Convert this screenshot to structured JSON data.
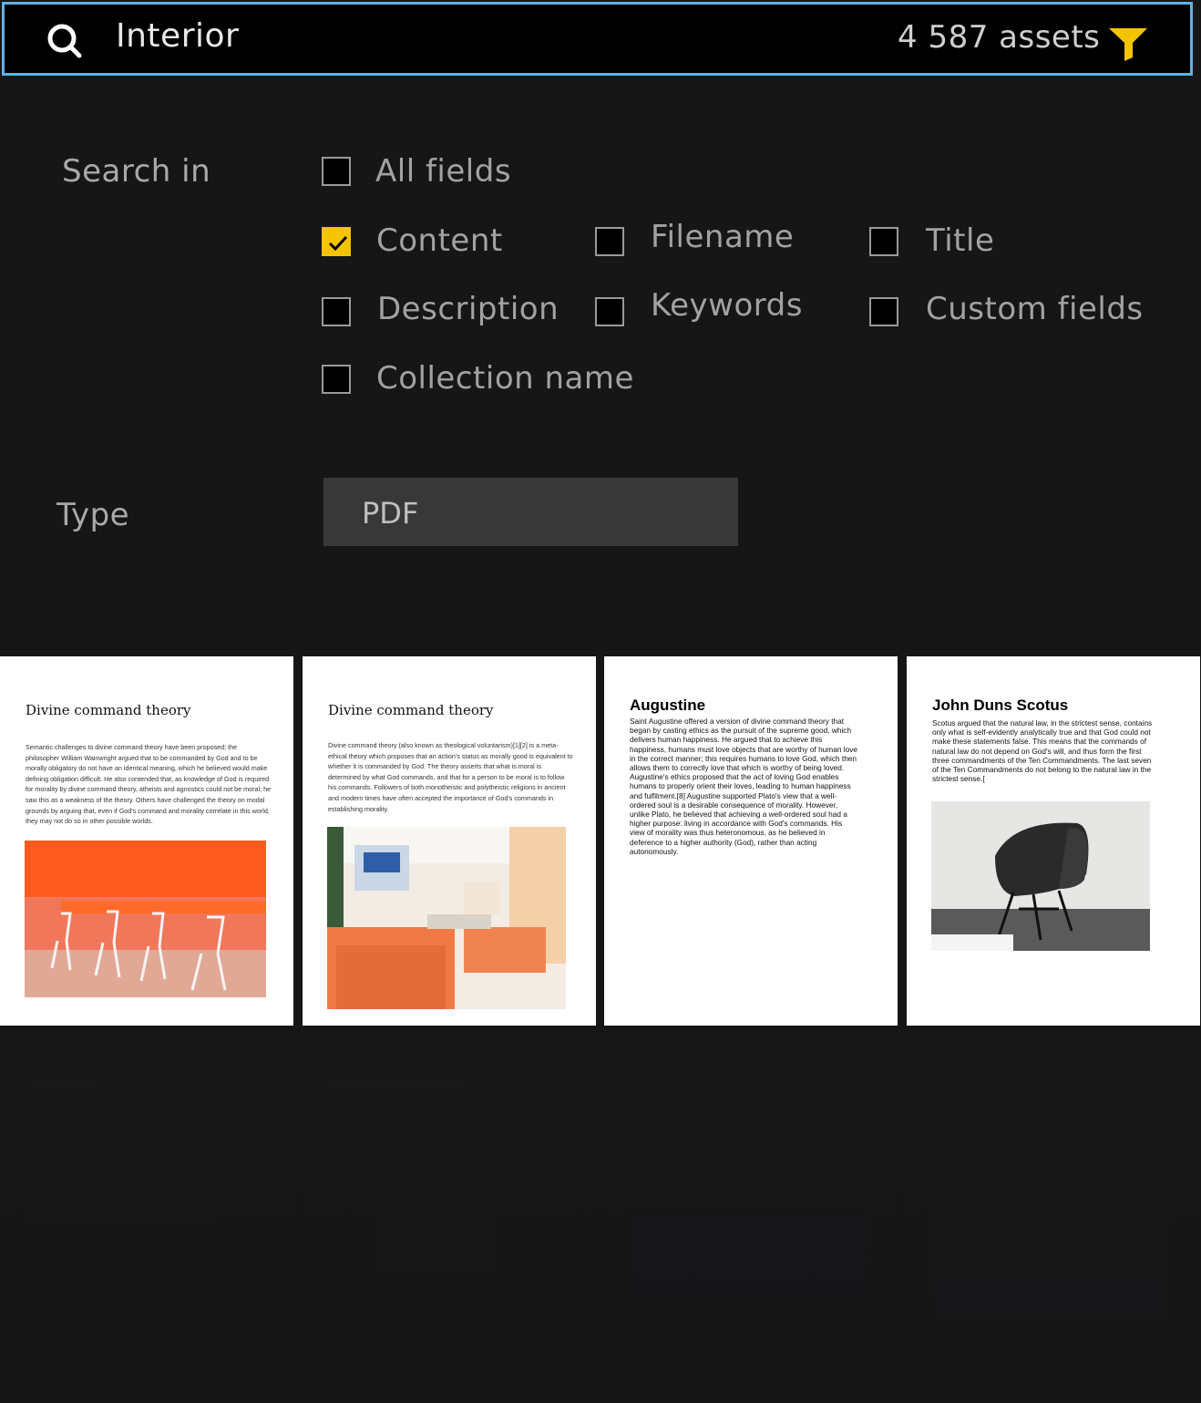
{
  "search": {
    "query": "Interior",
    "asset_count": "4 587 assets"
  },
  "search_in": {
    "label": "Search in",
    "options": [
      {
        "label": "All fields",
        "checked": false
      },
      {
        "label": "Content",
        "checked": true
      },
      {
        "label": "Filename",
        "checked": false
      },
      {
        "label": "Title",
        "checked": false
      },
      {
        "label": "Description",
        "checked": false
      },
      {
        "label": "Keywords",
        "checked": false
      },
      {
        "label": "Custom fields",
        "checked": false
      },
      {
        "label": "Collection name",
        "checked": false
      }
    ]
  },
  "type": {
    "label": "Type",
    "value": "PDF"
  },
  "results": [
    {
      "title": "Divine command theory",
      "body": "Semantic challenges to divine command theory have been proposed; the philosopher William Wainwright argued that to be commanded by God and to be morally obligatory do not have an identical meaning, which he believed would make defining obligation difficult. He also contended that, as knowledge of God is required for morality by divine command theory, atheists and agnostics could not be moral; he saw this as a weakness of the theory. Others have challenged the theory on modal grounds by arguing that, even if God's command and morality correlate in this world, they may not do so in other possible worlds."
    },
    {
      "title": "Divine command theory",
      "body": "Divine command theory (also known as theological voluntarism)[1][2] is a meta-ethical theory which proposes that an action's status as morally good is equivalent to whether it is commanded by God. The theory asserts that what is moral is determined by what God commands, and that for a person to be moral is to follow his commands. Followers of both monotheistic and polytheistic religions in ancient and modern times have often accepted the importance of God's commands in establishing morality."
    },
    {
      "title": "Augustine",
      "body": "Saint Augustine offered a version of divine command theory that began by casting ethics as the pursuit of the supreme good, which delivers human happiness. He argued that to achieve this happiness, humans must love objects that are worthy of human love in the correct manner; this requires humans to love God, which then allows them to correctly love that which is worthy of being loved. Augustine's ethics proposed that the act of loving God enables humans to properly orient their loves, leading to human happiness and fulfilment.[8] Augustine supported Plato's view that a well-ordered soul is a desirable consequence of morality. However, unlike Plato, he believed that achieving a well-ordered soul had a higher purpose: living in accordance with God's commands. His view of morality was thus heteronomous, as he believed in deference to a higher authority (God), rather than acting autonomously."
    },
    {
      "title": "John Duns Scotus",
      "body": "Scotus argued that the natural law, in the strictest sense, contains only what is self-evidently analytically true and that God could not make these statements false. This means that the commands of natural law do not depend on God's will, and thus form the first three commandments of the Ten Commandments. The last seven of the Ten Commandments do not belong to the natural law in the strictest sense.["
    }
  ],
  "colors": {
    "accent": "#f5c400",
    "focus_border": "#5eb3e6",
    "background": "#161616"
  },
  "icons": {
    "search": "search-icon",
    "filter": "filter-icon",
    "check": "check-icon"
  }
}
